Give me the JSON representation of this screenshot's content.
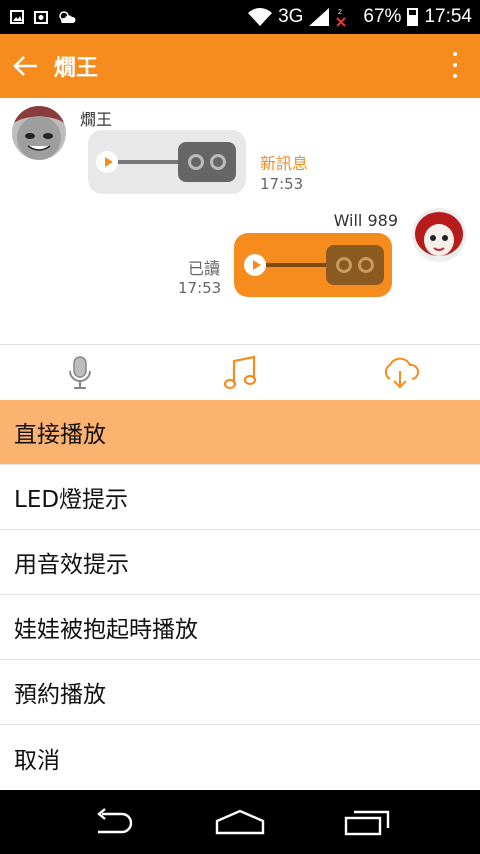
{
  "status_bar": {
    "network": "3G",
    "battery": "67%",
    "time": "17:54"
  },
  "app_bar": {
    "title": "燗王"
  },
  "chat": {
    "incoming": {
      "sender": "燗王",
      "status": "新訊息",
      "time": "17:53"
    },
    "outgoing": {
      "sender": "Will 989",
      "status": "已讀",
      "time": "17:53"
    }
  },
  "tabs": [
    {
      "icon": "microphone-icon"
    },
    {
      "icon": "music-note-icon"
    },
    {
      "icon": "cloud-download-icon"
    }
  ],
  "menu": {
    "selected_index": 0,
    "items": [
      "直接播放",
      "LED燈提示",
      "用音效提示",
      "娃娃被抱起時播放",
      "預約播放",
      "取消"
    ]
  },
  "colors": {
    "accent": "#f78c1e",
    "selected": "#fbb36f",
    "incoming_bubble": "#e8e8e8"
  }
}
